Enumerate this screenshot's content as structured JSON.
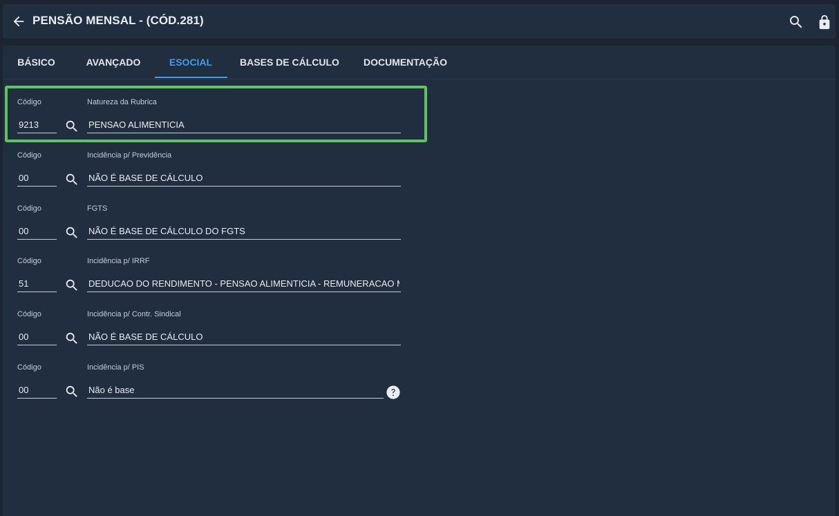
{
  "header": {
    "title": "PENSÃO MENSAL - (CÓD.281)",
    "back_icon": "arrow-left-icon",
    "search_icon": "search-icon",
    "lock_icon": "lock-icon"
  },
  "tabs": [
    {
      "label": "BÁSICO",
      "active": false
    },
    {
      "label": "AVANÇADO",
      "active": false
    },
    {
      "label": "ESOCIAL",
      "active": true
    },
    {
      "label": "BASES DE CÁLCULO",
      "active": false
    },
    {
      "label": "DOCUMENTAÇÃO",
      "active": false
    }
  ],
  "colors": {
    "accent": "#3c9ef0",
    "highlight": "#5ec45e",
    "background": "#1b2430",
    "panel": "#212e3f"
  },
  "fields": [
    {
      "code_label": "Código",
      "code": "9213",
      "desc_label": "Natureza da Rubrica",
      "desc": "PENSAO ALIMENTICIA"
    },
    {
      "code_label": "Código",
      "code": "00",
      "desc_label": "Incidência p/ Previdência",
      "desc": "NÃO É BASE DE CÁLCULO"
    },
    {
      "code_label": "Código",
      "code": "00",
      "desc_label": "FGTS",
      "desc": "NÃO É BASE DE CÁLCULO DO FGTS"
    },
    {
      "code_label": "Código",
      "code": "51",
      "desc_label": "Incidência p/ IRRF",
      "desc": "DEDUCAO DO RENDIMENTO - PENSAO ALIMENTICIA - REMUNERACAO MENSAL"
    },
    {
      "code_label": "Código",
      "code": "00",
      "desc_label": "Incidência p/ Contr. Sindical",
      "desc": "NÃO É BASE DE CÁLCULO"
    },
    {
      "code_label": "Código",
      "code": "00",
      "desc_label": "Incidência p/ PIS",
      "desc": "Não é base"
    }
  ]
}
